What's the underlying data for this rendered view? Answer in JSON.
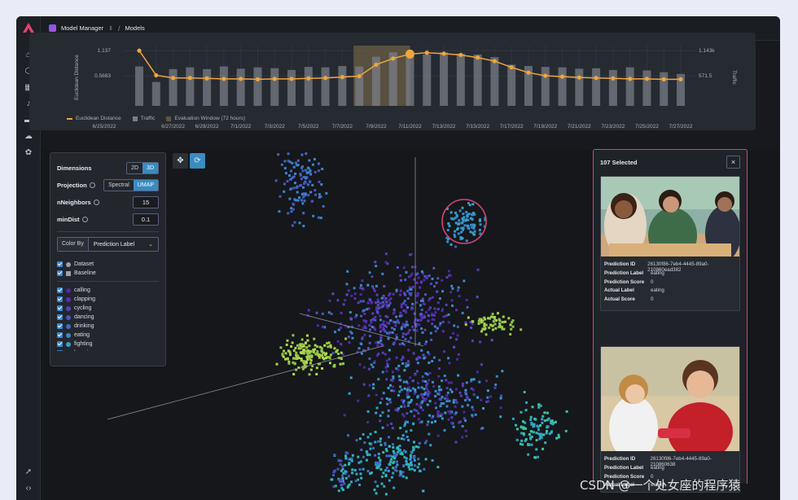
{
  "breadcrumb": {
    "project": "Model Manager",
    "page": "Models"
  },
  "chart_data": {
    "type": "line",
    "x": [
      "6/25/2022",
      "6/26/2022",
      "6/27/2022",
      "6/28/2022",
      "6/29/2022",
      "6/30/2022",
      "7/1/2022",
      "7/2/2022",
      "7/3/2022",
      "7/4/2022",
      "7/5/2022",
      "7/6/2022",
      "7/7/2022",
      "7/8/2022",
      "7/9/2022",
      "7/10/2022",
      "7/11/2022",
      "7/12/2022",
      "7/13/2022",
      "7/14/2022",
      "7/15/2022",
      "7/16/2022",
      "7/17/2022",
      "7/18/2022",
      "7/19/2022",
      "7/20/2022",
      "7/21/2022",
      "7/22/2022",
      "7/23/2022",
      "7/24/2022",
      "7/25/2022",
      "7/26/2022",
      "7/27/2022"
    ],
    "tick_labels": [
      "6/25/2022",
      "6/27/2022",
      "6/29/2022",
      "7/1/2022",
      "7/3/2022",
      "7/5/2022",
      "7/7/2022",
      "7/9/2022",
      "7/11/2022",
      "7/13/2022",
      "7/15/2022",
      "7/17/2022",
      "7/19/2022",
      "7/21/2022",
      "7/23/2022",
      "7/25/2022",
      "7/27/2022"
    ],
    "series": [
      {
        "name": "Euclidean Distance",
        "axis": "left",
        "color": "#f0a63c",
        "values": [
          1.137,
          0.58,
          0.52,
          0.52,
          0.51,
          0.5,
          0.5,
          0.49,
          0.5,
          0.5,
          0.51,
          0.52,
          0.54,
          0.56,
          0.82,
          0.96,
          1.06,
          1.09,
          1.07,
          1.04,
          0.98,
          0.9,
          0.76,
          0.64,
          0.57,
          0.55,
          0.53,
          0.52,
          0.51,
          0.5,
          0.5,
          0.49,
          0.49
        ]
      },
      {
        "name": "Traffic",
        "axis": "right",
        "color": "#7a7f89",
        "values": [
          780,
          430,
          720,
          760,
          720,
          780,
          730,
          760,
          740,
          700,
          770,
          760,
          790,
          780,
          1000,
          1100,
          1110,
          1050,
          1100,
          1070,
          1050,
          990,
          820,
          790,
          770,
          760,
          730,
          740,
          700,
          760,
          690,
          650,
          610
        ]
      }
    ],
    "ylabel": "Euclidean Distance",
    "ylabel_right": "Traffic",
    "yticks_left": [
      "1.137",
      "0.5683"
    ],
    "yticks_right": [
      "1.143k",
      "571.5"
    ],
    "ylim_left": [
      0,
      1.3
    ],
    "ylim_right": [
      0,
      1300
    ],
    "legend": [
      "Euclidean Distance",
      "Traffic",
      "Evaluation Window (72 hours)"
    ],
    "evaluation_window": [
      "7/8/2022",
      "7/11/2022"
    ],
    "highlight_point": "7/11/2022"
  },
  "controls": {
    "dimensions": {
      "label": "Dimensions",
      "options": [
        "2D",
        "3D"
      ],
      "selected": "3D"
    },
    "projection": {
      "label": "Projection",
      "options": [
        "Spectral",
        "UMAP"
      ],
      "selected": "UMAP"
    },
    "nneighbors": {
      "label": "nNeighbors",
      "value": "15"
    },
    "mindist": {
      "label": "minDist",
      "value": "0.1"
    },
    "colorby": {
      "label": "Color By",
      "value": "Prediction Label"
    },
    "datasets": [
      {
        "label": "Dataset",
        "marker": "dot",
        "color": "#9aa0ab"
      },
      {
        "label": "Baseline",
        "marker": "square",
        "color": "#9aa0ab"
      }
    ],
    "classes": [
      {
        "label": "calling",
        "color": "#4b2aa5"
      },
      {
        "label": "clapping",
        "color": "#5b2db5"
      },
      {
        "label": "cycling",
        "color": "#5441b8"
      },
      {
        "label": "dancing",
        "color": "#4b56bf"
      },
      {
        "label": "drinking",
        "color": "#3f6ac4"
      },
      {
        "label": "eating",
        "color": "#3a86c9"
      },
      {
        "label": "fighting",
        "color": "#33a0c8"
      },
      {
        "label": "hugging",
        "color": "#2eb7b6"
      }
    ]
  },
  "selection": {
    "title": "107 Selected",
    "close": "×",
    "cards": [
      {
        "fields": [
          {
            "k": "Prediction ID",
            "v": "26130f86-7eb4-4445-89a0-210860ead382"
          },
          {
            "k": "Prediction Label",
            "v": "eating"
          },
          {
            "k": "Prediction Score",
            "v": "0"
          },
          {
            "k": "Actual Label",
            "v": "eating"
          },
          {
            "k": "Actual Score",
            "v": "0"
          }
        ]
      },
      {
        "fields": [
          {
            "k": "Prediction ID",
            "v": "26130f86-7eb4-4445-89a0-210860638"
          },
          {
            "k": "Prediction Label",
            "v": "eating"
          },
          {
            "k": "Prediction Score",
            "v": "0"
          },
          {
            "k": "Actual Label",
            "v": "eating"
          }
        ]
      }
    ]
  },
  "watermark": "CSDN @一个处女座的程序猿",
  "colors": {
    "accent": "#3a8bc0",
    "brand": "#e8416e",
    "selection_border": "#d0457a",
    "line": "#f0a63c"
  }
}
